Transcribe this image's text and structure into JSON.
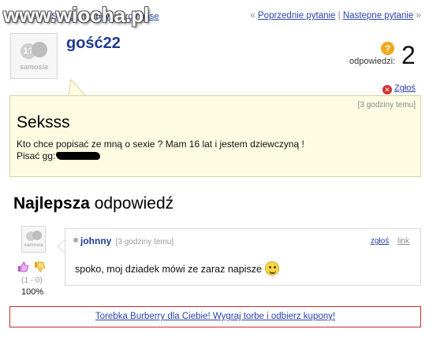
{
  "breadcrumb": {
    "prefix": "Kategoria:",
    "link_partial": "Samo...",
    "link_end": "rozrywka i romanse"
  },
  "watermark": "www.wiocha.pl",
  "nav": {
    "prev_label": "Poprzednie pytanie",
    "separator": "|",
    "next_label": "Nastepne pytanie",
    "left_quote": "«",
    "right_quote": "»"
  },
  "question": {
    "author": "gość22",
    "answers_label": "odpowiedzi:",
    "answers_count": "2",
    "report_label": "Zgłoś",
    "time": "[3 godziny temu]",
    "title": "Seksss",
    "body_line1": "Kto chce popisać ze mną o sexie ? Mam 16 lat i jestem dziewczyną !",
    "body_line2": "Pisać gg:"
  },
  "avatar": {
    "glyph": "1?",
    "brand": "samosia"
  },
  "best_answer": {
    "heading_bold": "Najlepsza",
    "heading_rest": "odpowiedź",
    "author": "johnny",
    "time": "[3 godziny temu]",
    "report_label": "zgłoś",
    "link_label": "link",
    "text": "spoko, moj dziadek mówi ze zaraz napisze",
    "votes": "(1 - 0)",
    "percent": "100%"
  },
  "promo": {
    "text": "Torebka Burberry dla Ciebie! Wygraj torbe i odbierz kupony!"
  },
  "colors": {
    "link": "#2a44aa",
    "username": "#1f3b93",
    "question_bg": "#fdfbe2",
    "promo_border": "#c62a2a",
    "answers_icon": "#f3a81c"
  },
  "icons": [
    "question-badge-icon",
    "report-x-icon",
    "thumb-up-icon",
    "thumb-down-icon",
    "smiley-icon"
  ]
}
